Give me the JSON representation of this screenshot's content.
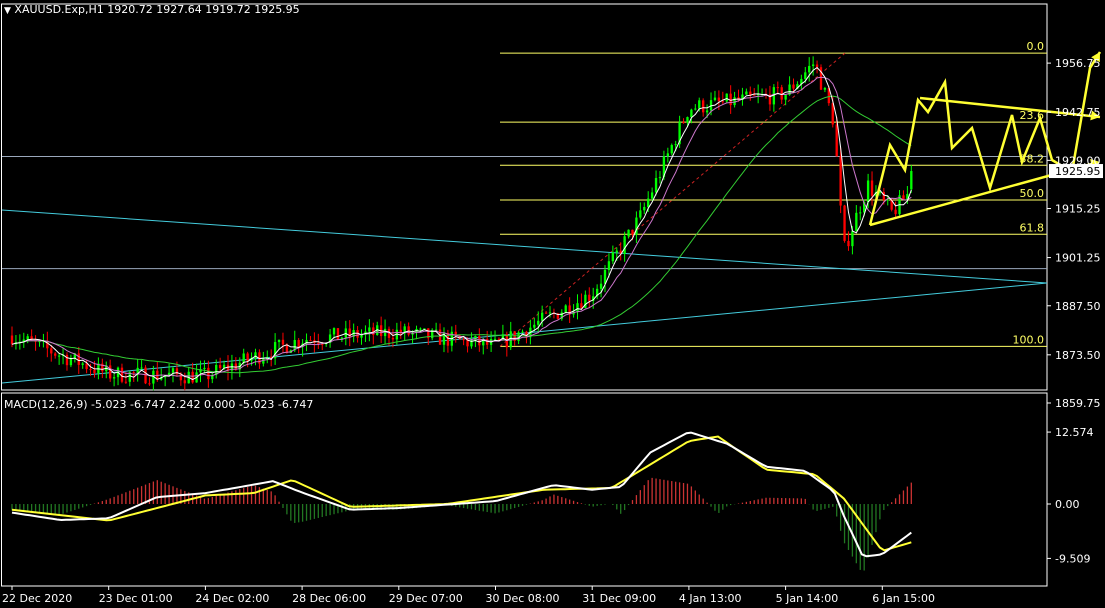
{
  "header": {
    "symbol_line": "XAUUSD.Exp,H1  1920.72 1927.64 1919.72 1925.95",
    "menu_icon": "triangle-down-icon"
  },
  "colors": {
    "background": "#000000",
    "frame": "#ffffff",
    "bull_candle": "#00ff00",
    "bear_candle": "#ff0000",
    "fib_levels": "#ffff66",
    "trendline": "#44ccdd",
    "ma_slow": "#33cc33",
    "ma_fast": "#ffffff",
    "ma_mid": "#cc77cc",
    "projection": "#ffff33",
    "macd_main": "#ffffff",
    "macd_signal": "#ffff33",
    "hist_up": "#cc3333",
    "hist_down": "#227722"
  },
  "chart_data": [
    {
      "type": "candlestick",
      "title": "XAUUSD.Exp,H1",
      "ohlc_last": {
        "open": 1920.72,
        "high": 1927.64,
        "low": 1919.72,
        "close": 1925.95
      },
      "current_price_label": "1925.95",
      "y_ticks": [
        "1956.75",
        "1942.75",
        "1929.00",
        "1915.25",
        "1901.25",
        "1887.50",
        "1873.50",
        "1859.75"
      ],
      "ylim": [
        1855,
        1963
      ],
      "x_ticks": [
        "22 Dec 2020",
        "23 Dec 01:00",
        "24 Dec 02:00",
        "28 Dec 06:00",
        "29 Dec 07:00",
        "30 Dec 08:00",
        "31 Dec 09:00",
        "4 Jan 13:00",
        "5 Jan 14:00",
        "6 Jan 15:00"
      ],
      "fibonacci": {
        "low": 1875.9,
        "high": 1959.6,
        "levels": [
          {
            "label": "0.0",
            "price": 1959.6
          },
          {
            "label": "23.6",
            "price": 1939.9
          },
          {
            "label": "38.2",
            "price": 1927.6
          },
          {
            "label": "50.0",
            "price": 1917.7
          },
          {
            "label": "61.8",
            "price": 1907.9
          },
          {
            "label": "100.0",
            "price": 1875.9
          }
        ]
      },
      "horizontal_lines": [
        1930.1,
        1898.1
      ],
      "anchor_path": [
        {
          "x": 0,
          "price": 1879.0
        },
        {
          "x": 1,
          "price": 1868.0
        },
        {
          "x": 2,
          "price": 1867.5
        },
        {
          "x": 3,
          "price": 1878.0
        },
        {
          "x": 4,
          "price": 1880.0
        },
        {
          "x": 5,
          "price": 1876.0
        },
        {
          "x": 6,
          "price": 1891.0
        },
        {
          "x": 6.5,
          "price": 1913.0
        },
        {
          "x": 7,
          "price": 1944.0
        },
        {
          "x": 8,
          "price": 1948.0
        },
        {
          "x": 8.3,
          "price": 1957.0
        },
        {
          "x": 8.5,
          "price": 1940.0
        },
        {
          "x": 8.6,
          "price": 1903.0
        },
        {
          "x": 8.85,
          "price": 1922.0
        },
        {
          "x": 9.1,
          "price": 1914.0
        },
        {
          "x": 9.3,
          "price": 1920.5
        }
      ],
      "macd": {
        "label": "MACD(12,26,9) -5.023 -6.747 2.242 0.000 -5.023 -6.747",
        "y_ticks": [
          "12.574",
          "0.00",
          "-9.509"
        ],
        "ylim": [
          -10.5,
          13.5
        ],
        "main_path": [
          {
            "x": 0,
            "v": -1.5
          },
          {
            "x": 0.5,
            "v": -2.8
          },
          {
            "x": 1,
            "v": -2.5
          },
          {
            "x": 1.5,
            "v": 1.2
          },
          {
            "x": 2,
            "v": 1.9
          },
          {
            "x": 2.7,
            "v": 4.0
          },
          {
            "x": 3,
            "v": 2.0
          },
          {
            "x": 3.5,
            "v": -1.0
          },
          {
            "x": 4,
            "v": -0.7
          },
          {
            "x": 5,
            "v": 0.5
          },
          {
            "x": 5.6,
            "v": 3.3
          },
          {
            "x": 6,
            "v": 2.5
          },
          {
            "x": 6.3,
            "v": 3.0
          },
          {
            "x": 6.6,
            "v": 9.0
          },
          {
            "x": 7,
            "v": 12.6
          },
          {
            "x": 7.4,
            "v": 10.5
          },
          {
            "x": 7.8,
            "v": 6.5
          },
          {
            "x": 8.2,
            "v": 5.8
          },
          {
            "x": 8.5,
            "v": 2.2
          },
          {
            "x": 8.6,
            "v": -2.0
          },
          {
            "x": 8.8,
            "v": -9.2
          },
          {
            "x": 9.0,
            "v": -8.8
          },
          {
            "x": 9.3,
            "v": -5.0
          }
        ],
        "signal_path": [
          {
            "x": 0,
            "v": -1.0
          },
          {
            "x": 1,
            "v": -2.9
          },
          {
            "x": 2,
            "v": 1.5
          },
          {
            "x": 2.5,
            "v": 1.9
          },
          {
            "x": 2.9,
            "v": 4.2
          },
          {
            "x": 3.5,
            "v": -0.5
          },
          {
            "x": 4.5,
            "v": 0.0
          },
          {
            "x": 5.5,
            "v": 2.5
          },
          {
            "x": 6.2,
            "v": 2.8
          },
          {
            "x": 7,
            "v": 11.0
          },
          {
            "x": 7.3,
            "v": 11.8
          },
          {
            "x": 7.8,
            "v": 6.0
          },
          {
            "x": 8.3,
            "v": 5.2
          },
          {
            "x": 8.6,
            "v": 1.0
          },
          {
            "x": 9.0,
            "v": -8.2
          },
          {
            "x": 9.3,
            "v": -6.7
          }
        ]
      }
    }
  ]
}
